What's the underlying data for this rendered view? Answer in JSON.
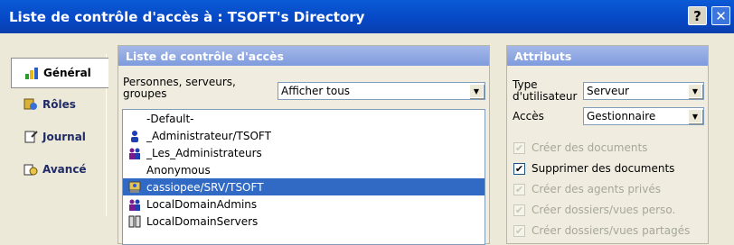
{
  "window": {
    "title": "Liste de contrôle d'accès à : TSOFT's Directory",
    "help_label": "?",
    "close_label": "✕"
  },
  "nav": [
    {
      "label": "Général",
      "icon": "general-icon",
      "active": true
    },
    {
      "label": "Rôles",
      "icon": "roles-icon",
      "active": false
    },
    {
      "label": "Journal",
      "icon": "journal-icon",
      "active": false
    },
    {
      "label": "Avancé",
      "icon": "advanced-icon",
      "active": false
    }
  ],
  "acl_panel": {
    "header": "Liste de contrôle d'accès",
    "filter_label": "Personnes, serveurs, groupes",
    "filter_value": "Afficher tous",
    "entries": [
      {
        "name": "-Default-",
        "icon": "none"
      },
      {
        "name": "_Administrateur/TSOFT",
        "icon": "person-icon"
      },
      {
        "name": "_Les_Administrateurs",
        "icon": "group-icon"
      },
      {
        "name": "Anonymous",
        "icon": "none"
      },
      {
        "name": "cassiopee/SRV/TSOFT",
        "icon": "server-icon",
        "selected": true
      },
      {
        "name": "LocalDomainAdmins",
        "icon": "group-icon"
      },
      {
        "name": "LocalDomainServers",
        "icon": "server-group-icon"
      }
    ]
  },
  "attributes": {
    "header": "Attributs",
    "user_type_label": "Type d'utilisateur",
    "user_type_value": "Serveur",
    "access_label": "Accès",
    "access_value": "Gestionnaire",
    "options": [
      {
        "label": "Créer des documents",
        "checked": true,
        "disabled": true
      },
      {
        "label": "Supprimer des documents",
        "checked": true,
        "disabled": false
      },
      {
        "label": "Créer des agents privés",
        "checked": true,
        "disabled": true
      },
      {
        "label": "Créer dossiers/vues perso.",
        "checked": true,
        "disabled": true
      },
      {
        "label": "Créer dossiers/vues partagés",
        "checked": true,
        "disabled": true
      }
    ]
  }
}
